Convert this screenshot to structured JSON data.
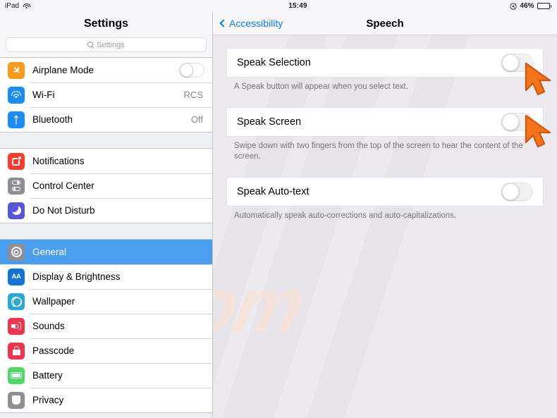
{
  "status_bar": {
    "device": "iPad",
    "wifi_icon": "wifi-icon",
    "time": "15:49",
    "location_icon": "location-arrow-icon",
    "battery_percent": "46%",
    "battery_level": 46
  },
  "sidebar": {
    "title": "Settings",
    "search": {
      "placeholder": "Settings",
      "icon": "search-icon"
    },
    "groups": [
      {
        "items": [
          {
            "label": "Airplane Mode",
            "icon": "airplane-icon",
            "color": "#f89a1c",
            "control": "toggle",
            "value": ""
          },
          {
            "label": "Wi-Fi",
            "icon": "wifi-icon",
            "color": "#1a8cf7",
            "control": "value",
            "value": "RCS"
          },
          {
            "label": "Bluetooth",
            "icon": "bluetooth-icon",
            "color": "#1a8cf7",
            "control": "value",
            "value": "Off"
          }
        ]
      },
      {
        "items": [
          {
            "label": "Notifications",
            "icon": "notifications-icon",
            "color": "#ff3b30",
            "control": "none",
            "value": ""
          },
          {
            "label": "Control Center",
            "icon": "control-center-icon",
            "color": "#8e8e93",
            "control": "none",
            "value": ""
          },
          {
            "label": "Do Not Disturb",
            "icon": "moon-icon",
            "color": "#5755d9",
            "control": "none",
            "value": ""
          }
        ]
      },
      {
        "items": [
          {
            "label": "General",
            "icon": "gear-icon",
            "color": "#8e8e93",
            "control": "none",
            "value": "",
            "selected": true
          },
          {
            "label": "Display & Brightness",
            "icon": "display-brightness-icon",
            "color": "#1175d8",
            "control": "none",
            "value": ""
          },
          {
            "label": "Wallpaper",
            "icon": "wallpaper-icon",
            "color": "#2aa9d8",
            "control": "none",
            "value": ""
          },
          {
            "label": "Sounds",
            "icon": "sounds-icon",
            "color": "#f2334f",
            "control": "none",
            "value": ""
          },
          {
            "label": "Passcode",
            "icon": "lock-icon",
            "color": "#f2334f",
            "control": "none",
            "value": ""
          },
          {
            "label": "Battery",
            "icon": "battery-icon",
            "color": "#4cd964",
            "control": "none",
            "value": ""
          },
          {
            "label": "Privacy",
            "icon": "privacy-hand-icon",
            "color": "#8e8e93",
            "control": "none",
            "value": ""
          }
        ]
      }
    ]
  },
  "detail": {
    "back_label": "Accessibility",
    "back_icon": "chevron-left-icon",
    "title": "Speech",
    "rows": [
      {
        "label": "Speak Selection",
        "toggle_state": "off",
        "footer": "A Speak button will appear when you select text."
      },
      {
        "label": "Speak Screen",
        "toggle_state": "off",
        "footer": "Swipe down with two fingers from the top of the screen to hear the content of the screen."
      },
      {
        "label": "Speak Auto-text",
        "toggle_state": "off",
        "footer": "Automatically speak auto-corrections and auto-capitalizations."
      }
    ]
  },
  "cursors": [
    {
      "name": "pointer-speak-selection",
      "color": "#f4731c"
    },
    {
      "name": "pointer-speak-screen",
      "color": "#f4731c"
    }
  ],
  "watermark": {
    "text": ".com",
    "color": "#f7e3d8"
  },
  "colors": {
    "accent_blue": "#0a7cff",
    "selected_row": "#4a9ef0",
    "page_bg": "#eceaee",
    "cell_bg": "#ffffff"
  }
}
